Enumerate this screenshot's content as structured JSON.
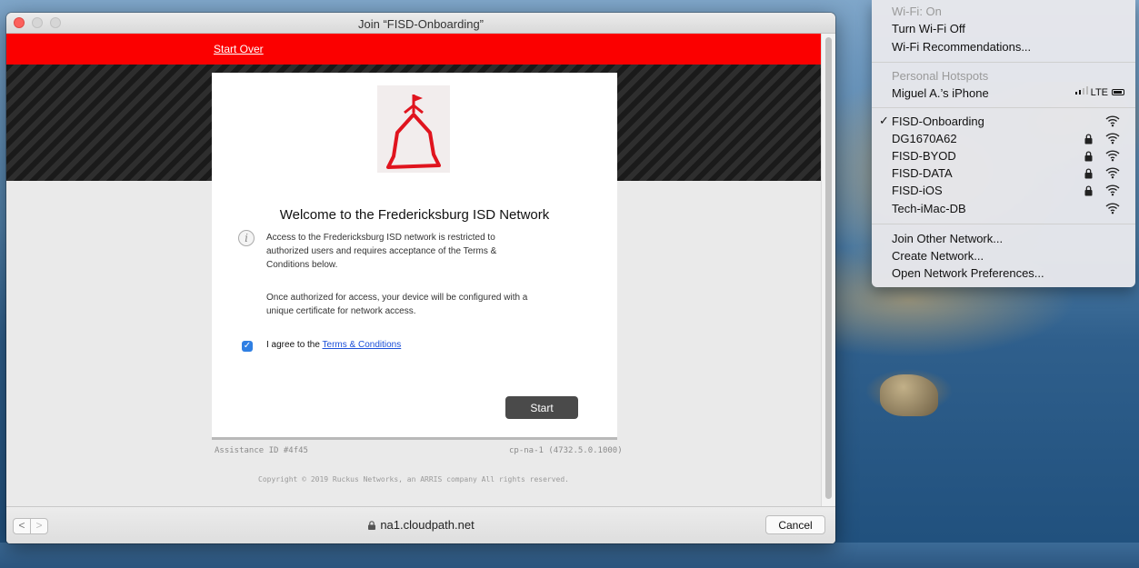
{
  "window": {
    "title": "Join “FISD-Onboarding”"
  },
  "portal": {
    "start_over": "Start Over",
    "welcome_title": "Welcome to the Fredericksburg ISD Network",
    "paragraph1": "Access to the Fredericksburg ISD network is restricted to authorized users and requires acceptance of the Terms & Conditions below.",
    "paragraph2": "Once authorized for access, your device will be configured with a unique certificate for network access.",
    "agree_prefix": "I agree to the ",
    "terms_link": "Terms & Conditions",
    "agree_checked": true,
    "start_button": "Start",
    "assistance_id": "Assistance ID #4f45",
    "build": "cp-na-1 (4732.5.0.1000)",
    "copyright": "Copyright © 2019 Ruckus Networks, an ARRIS company All rights reserved."
  },
  "bottombar": {
    "back": "<",
    "forward": ">",
    "url": "na1.cloudpath.net",
    "cancel": "Cancel"
  },
  "wifi_menu": {
    "status": "Wi-Fi: On",
    "turn_off": "Turn Wi-Fi Off",
    "recommendations": "Wi-Fi Recommendations...",
    "hotspots_header": "Personal Hotspots",
    "hotspot_name": "Miguel A.’s iPhone",
    "hotspot_network_type": "LTE",
    "checkmark": "✓",
    "networks": [
      {
        "name": "FISD-Onboarding",
        "connected": true,
        "locked": false
      },
      {
        "name": "DG1670A62",
        "connected": false,
        "locked": true
      },
      {
        "name": "FISD-BYOD",
        "connected": false,
        "locked": true
      },
      {
        "name": "FISD-DATA",
        "connected": false,
        "locked": true
      },
      {
        "name": "FISD-iOS",
        "connected": false,
        "locked": true
      },
      {
        "name": "Tech-iMac-DB",
        "connected": false,
        "locked": false
      }
    ],
    "join_other": "Join Other Network...",
    "create_network": "Create Network...",
    "open_prefs": "Open Network Preferences..."
  },
  "colors": {
    "red_bar": "#fb0000",
    "link_blue": "#1b4fd8",
    "checkbox_blue": "#2f7fe3",
    "start_button_bg": "#4a4a4a"
  }
}
